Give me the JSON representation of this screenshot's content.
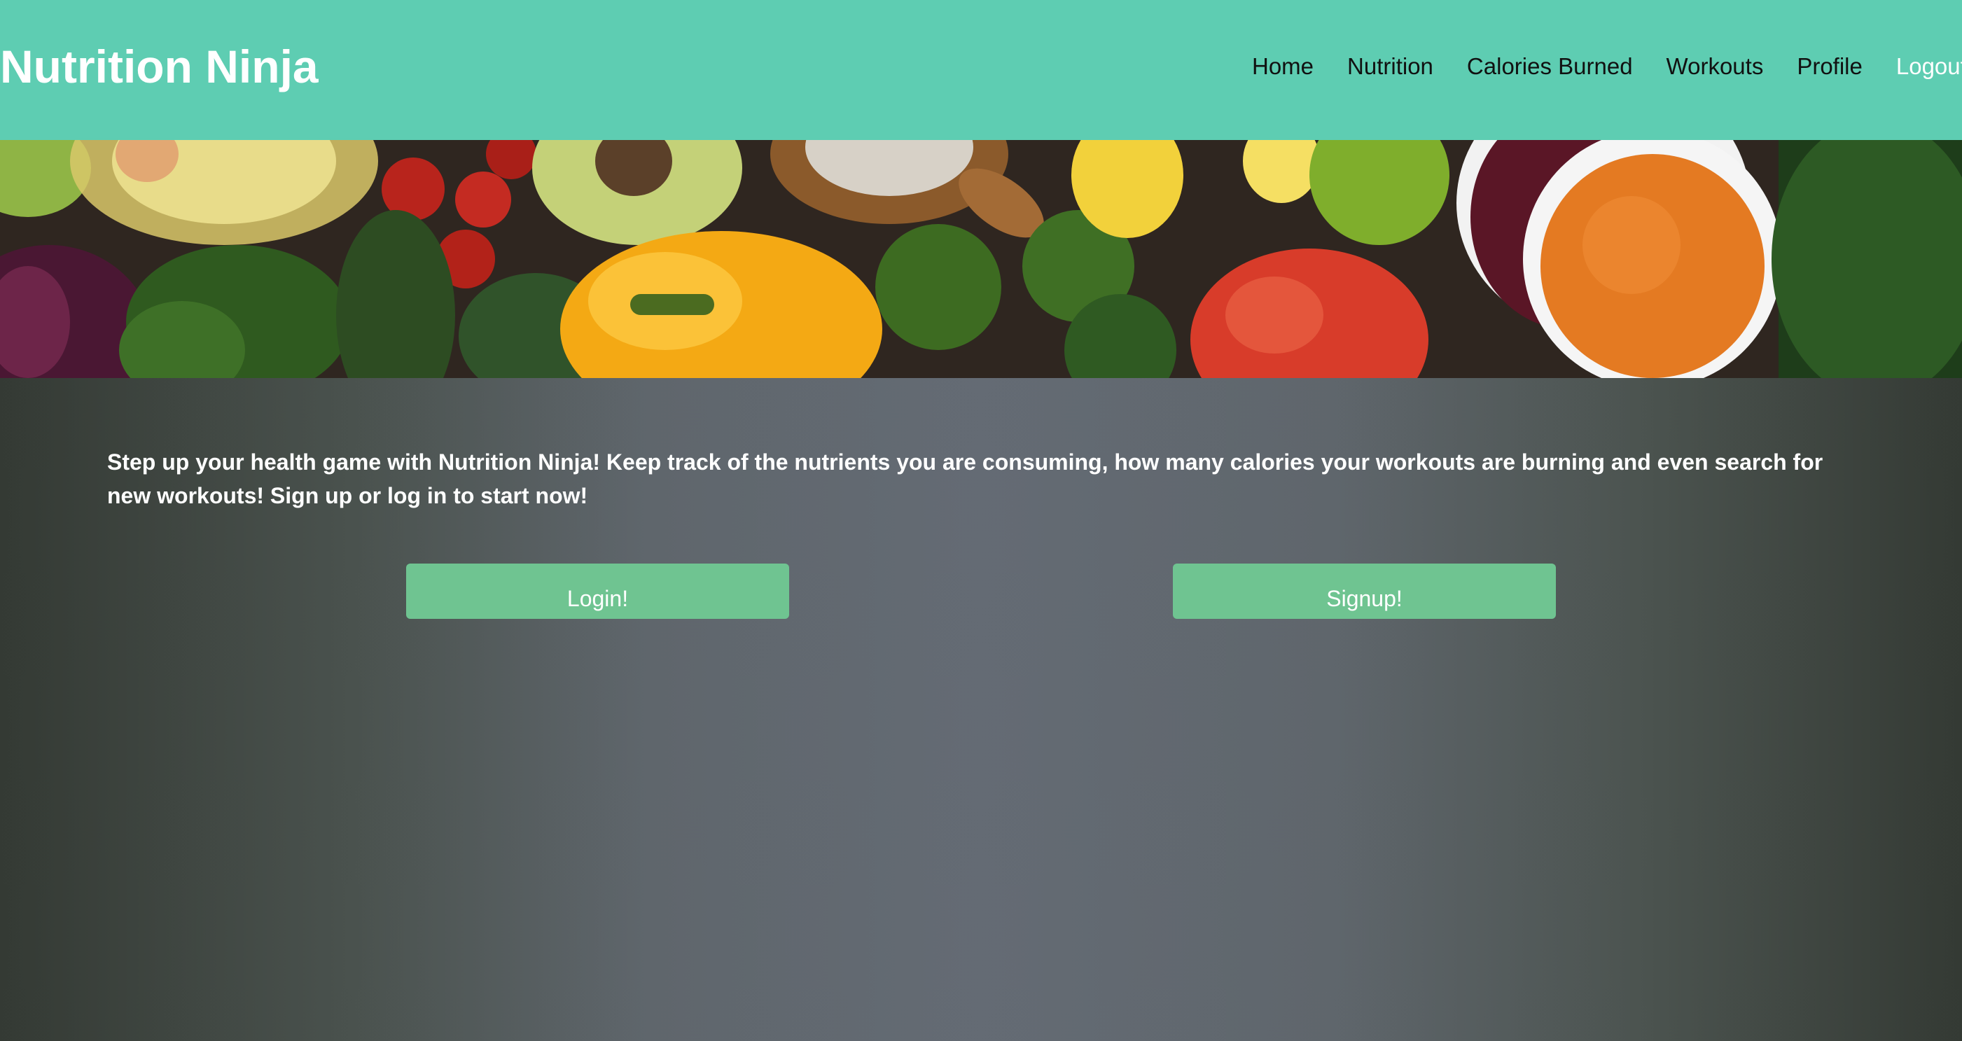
{
  "app": {
    "title": "Nutrition Ninja"
  },
  "nav": {
    "items": [
      {
        "label": "Home"
      },
      {
        "label": "Nutrition"
      },
      {
        "label": "Calories Burned"
      },
      {
        "label": "Workouts"
      },
      {
        "label": "Profile"
      },
      {
        "label": "Logout"
      }
    ]
  },
  "banner": {
    "description": "vegetables-banner-image"
  },
  "main": {
    "intro": "Step up your health game with Nutrition Ninja! Keep track of the nutrients you are consuming, how many calories your workouts are burning and even search for new workouts! Sign up or log in to start now!",
    "login_label": "Login!",
    "signup_label": "Signup!"
  },
  "colors": {
    "header": "#5ecdb2",
    "button": "#6fc491",
    "background": "#5f666c"
  }
}
